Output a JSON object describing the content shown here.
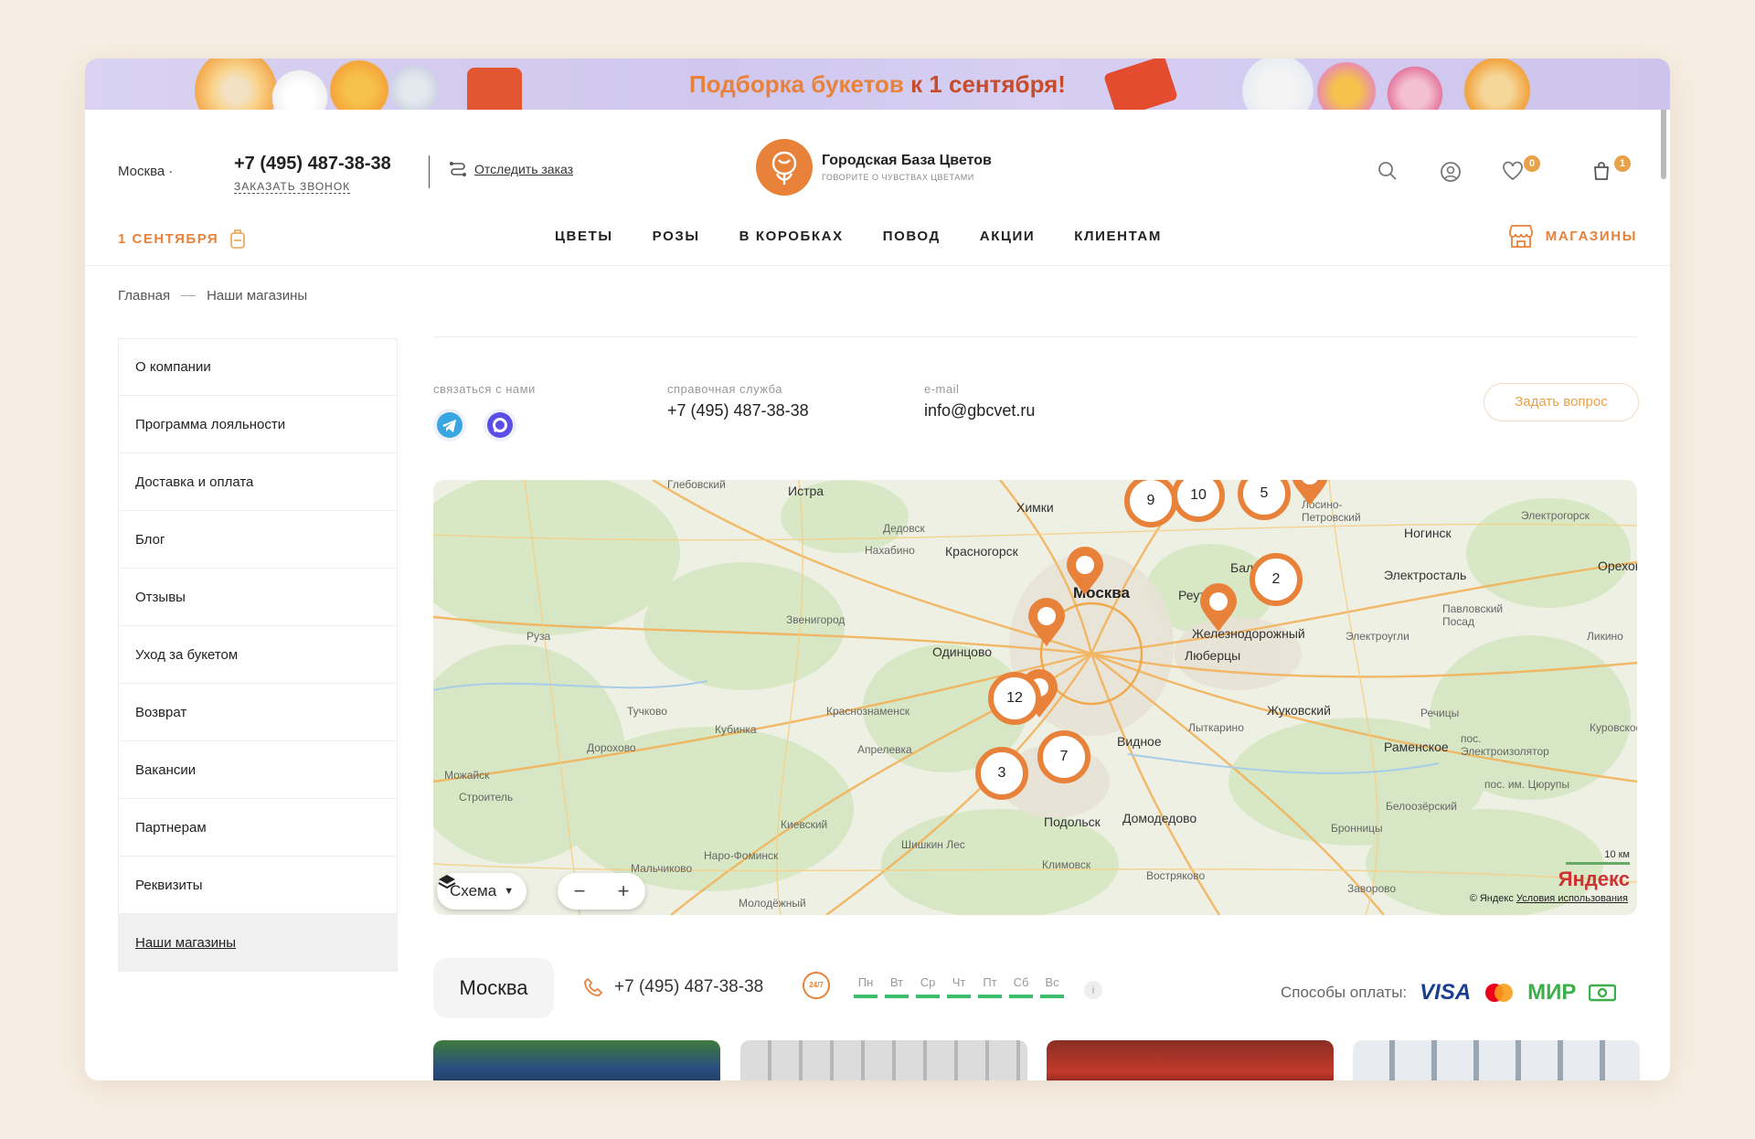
{
  "banner": {
    "text_orange": "Подборка букетов",
    "text_dark": "к 1 сентября!"
  },
  "header": {
    "city": "Москва",
    "phone": "+7 (495) 487-38-38",
    "callback": "заказать звонок",
    "track_order": "Отследить заказ",
    "logo_title": "Городская База Цветов",
    "logo_sub": "ГОВОРИТЕ О ЧУВСТВАХ ЦВЕТАМИ",
    "favorites_count": "0",
    "cart_count": "1"
  },
  "nav": {
    "promo": "1 СЕНТЯБРЯ",
    "items": [
      "ЦВЕТЫ",
      "РОЗЫ",
      "В КОРОБКАХ",
      "ПОВОД",
      "АКЦИИ",
      "КЛИЕНТАМ"
    ],
    "stores": "МАГАЗИНЫ"
  },
  "breadcrumbs": [
    "Главная",
    "Наши магазины"
  ],
  "sidebar": {
    "items": [
      "О компании",
      "Программа лояльности",
      "Доставка и оплата",
      "Блог",
      "Отзывы",
      "Уход за букетом",
      "Возврат",
      "Вакансии",
      "Партнерам",
      "Реквизиты",
      "Наши магазины"
    ]
  },
  "contacts": {
    "contact_label": "связаться с нами",
    "help_label": "справочная служба",
    "help_phone": "+7 (495) 487-38-38",
    "email_label": "e-mail",
    "email": "info@gbcvet.ru",
    "ask_button": "Задать вопрос"
  },
  "map": {
    "labels": [
      "Глебовский",
      "Истра",
      "Химки",
      "Лосино-Петровский",
      "Электрогорск",
      "Ногинск",
      "Дедовск",
      "Нахабино",
      "Красногорск",
      "Москва",
      "Балашиха",
      "Реутов",
      "Электросталь",
      "Орехово",
      "Павловский Посад",
      "Ликино",
      "Звенигород",
      "Руза",
      "Одинцово",
      "Железнодорожный",
      "Электроугли",
      "Люберцы",
      "Тучково",
      "Кубинка",
      "Краснознаменск",
      "Жуковский",
      "Речицы",
      "Куровское",
      "Дорохово",
      "Апрелевка",
      "Видное",
      "Лыткарино",
      "Раменское",
      "пос. Электроизолятор",
      "Можайск",
      "Строитель",
      "пос. им. Цюрупы",
      "Белоозёрский",
      "Киевский",
      "Подольск",
      "Домодедово",
      "Бронницы",
      "Наро-Фоминск",
      "Шишкин Лес",
      "Климовск",
      "Востряково",
      "Заворово",
      "Молодёжный",
      "Мальчиково"
    ],
    "clusters": [
      "9",
      "10",
      "5",
      "2",
      "12",
      "7",
      "3"
    ],
    "scheme_label": "Схема",
    "scale": "10 км",
    "brand": "Яндекс",
    "attribution": "© Яндекс",
    "terms": "Условия использования"
  },
  "store_bar": {
    "city": "Москва",
    "phone": "+7 (495) 487-38-38",
    "hours_badge": "24/7",
    "days": [
      "Пн",
      "Вт",
      "Ср",
      "Чт",
      "Пт",
      "Сб",
      "Вс"
    ],
    "info": "i",
    "payment_label": "Способы оплаты:",
    "payment_methods": [
      "VISA",
      "Mastercard",
      "МИР",
      "cash"
    ]
  },
  "colors": {
    "accent": "#e8823a",
    "badge": "#e8a24a",
    "open_day": "#3cbe6e"
  }
}
